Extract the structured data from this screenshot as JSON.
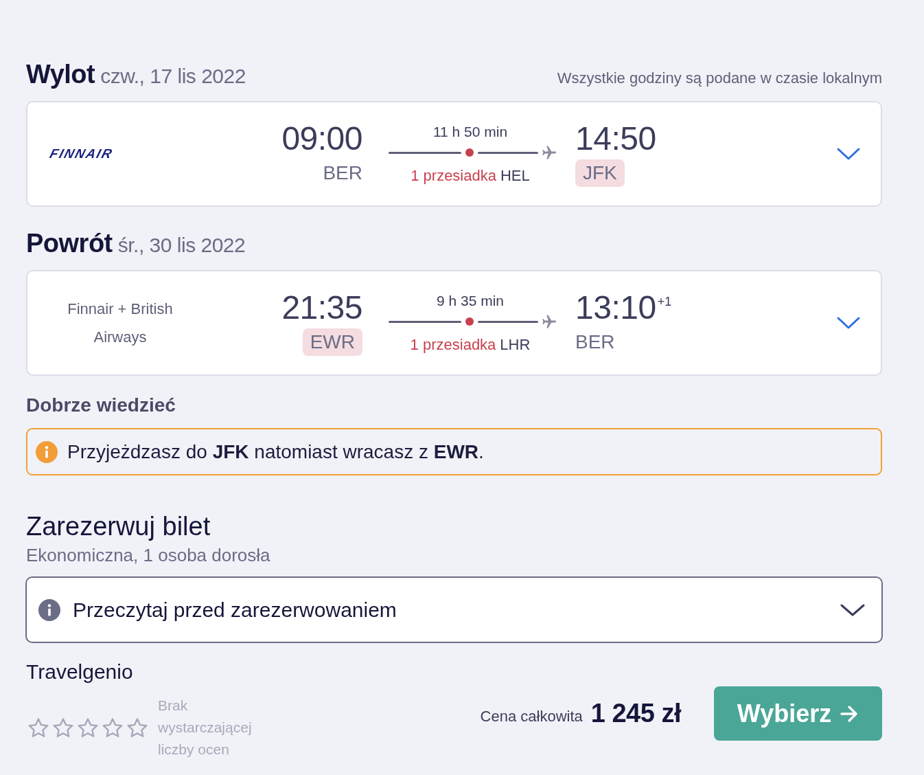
{
  "legs": [
    {
      "title": "Wylot",
      "date": "czw., 17 lis 2022",
      "note": "Wszystkie godziny są podane w czasie lokalnym",
      "airline": {
        "kind": "logo",
        "name": "FINNAIR"
      },
      "departure": {
        "time": "09:00",
        "airport": "BER",
        "highlighted": false
      },
      "duration": "11 h 50 min",
      "stops": "1 przesiadka",
      "via": "HEL",
      "arrival": {
        "time": "14:50",
        "airport": "JFK",
        "highlighted": true
      },
      "expanded": false
    },
    {
      "title": "Powrót",
      "date": "śr., 30 lis 2022",
      "airline": {
        "kind": "text",
        "name": "Finnair + British Airways"
      },
      "departure": {
        "time": "21:35",
        "airport": "EWR",
        "highlighted": true
      },
      "duration": "9 h 35 min",
      "stops": "1 przesiadka",
      "via": "LHR",
      "arrival": {
        "time": "13:10",
        "day_offset": "+1",
        "airport": "BER",
        "highlighted": false
      },
      "expanded": false
    }
  ],
  "good_to_know": {
    "title": "Dobrze wiedzieć",
    "notice": "Przyjeżdzasz do **JFK** natomiast wracasz z **EWR**."
  },
  "booking": {
    "title": "Zarezerwuj bilet",
    "subtitle": "Ekonomiczna, 1 osoba dorosła",
    "details": {
      "label": "Przeczytaj przed zarezerwowaniem",
      "expanded": false
    },
    "provider": "Travelgenio",
    "stars": 0,
    "rating_note": "Brak wystarczającej liczby ocen",
    "price_label": "Cena całkowita",
    "price": "1 245 zł",
    "button": "Wybierz"
  }
}
